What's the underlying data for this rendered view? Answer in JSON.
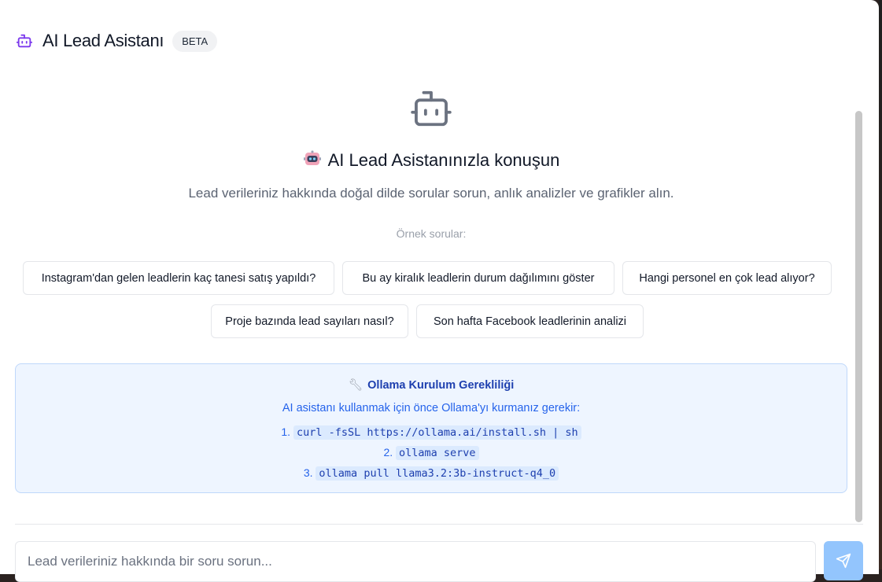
{
  "header": {
    "title": "AI Lead Asistanı",
    "badge": "BETA"
  },
  "hero": {
    "title": "AI Lead Asistanınızla konuşun",
    "subtitle": "Lead verileriniz hakkında doğal dilde sorular sorun, anlık analizler ve grafikler alın."
  },
  "examples": {
    "label": "Örnek sorular:",
    "items": [
      "Instagram'dan gelen leadlerin kaç tanesi satış yapıldı?",
      "Bu ay kiralık leadlerin durum dağılımını göster",
      "Hangi personel en çok lead alıyor?",
      "Proje bazında lead sayıları nasıl?",
      "Son hafta Facebook leadlerinin analizi"
    ]
  },
  "setup": {
    "title": "Ollama Kurulum Gerekliliği",
    "description": "AI asistanı kullanmak için önce Ollama'yı kurmanız gerekir:",
    "steps": [
      {
        "num": "1.",
        "cmd": "curl -fsSL https://ollama.ai/install.sh | sh"
      },
      {
        "num": "2.",
        "cmd": "ollama serve"
      },
      {
        "num": "3.",
        "cmd": "ollama pull llama3.2:3b-instruct-q4_0"
      }
    ]
  },
  "composer": {
    "placeholder": "Lead verileriniz hakkında bir soru sorun...",
    "value": ""
  },
  "colors": {
    "accent": "#7c3aed",
    "info_bg": "#eef5ff",
    "info_text": "#2563eb",
    "send_button": "#93c5fd"
  },
  "icons": {
    "header": "bot-icon",
    "hero": "bot-icon",
    "hero_title": "robot-emoji-icon",
    "setup": "wrench-icon",
    "send": "send-icon"
  }
}
